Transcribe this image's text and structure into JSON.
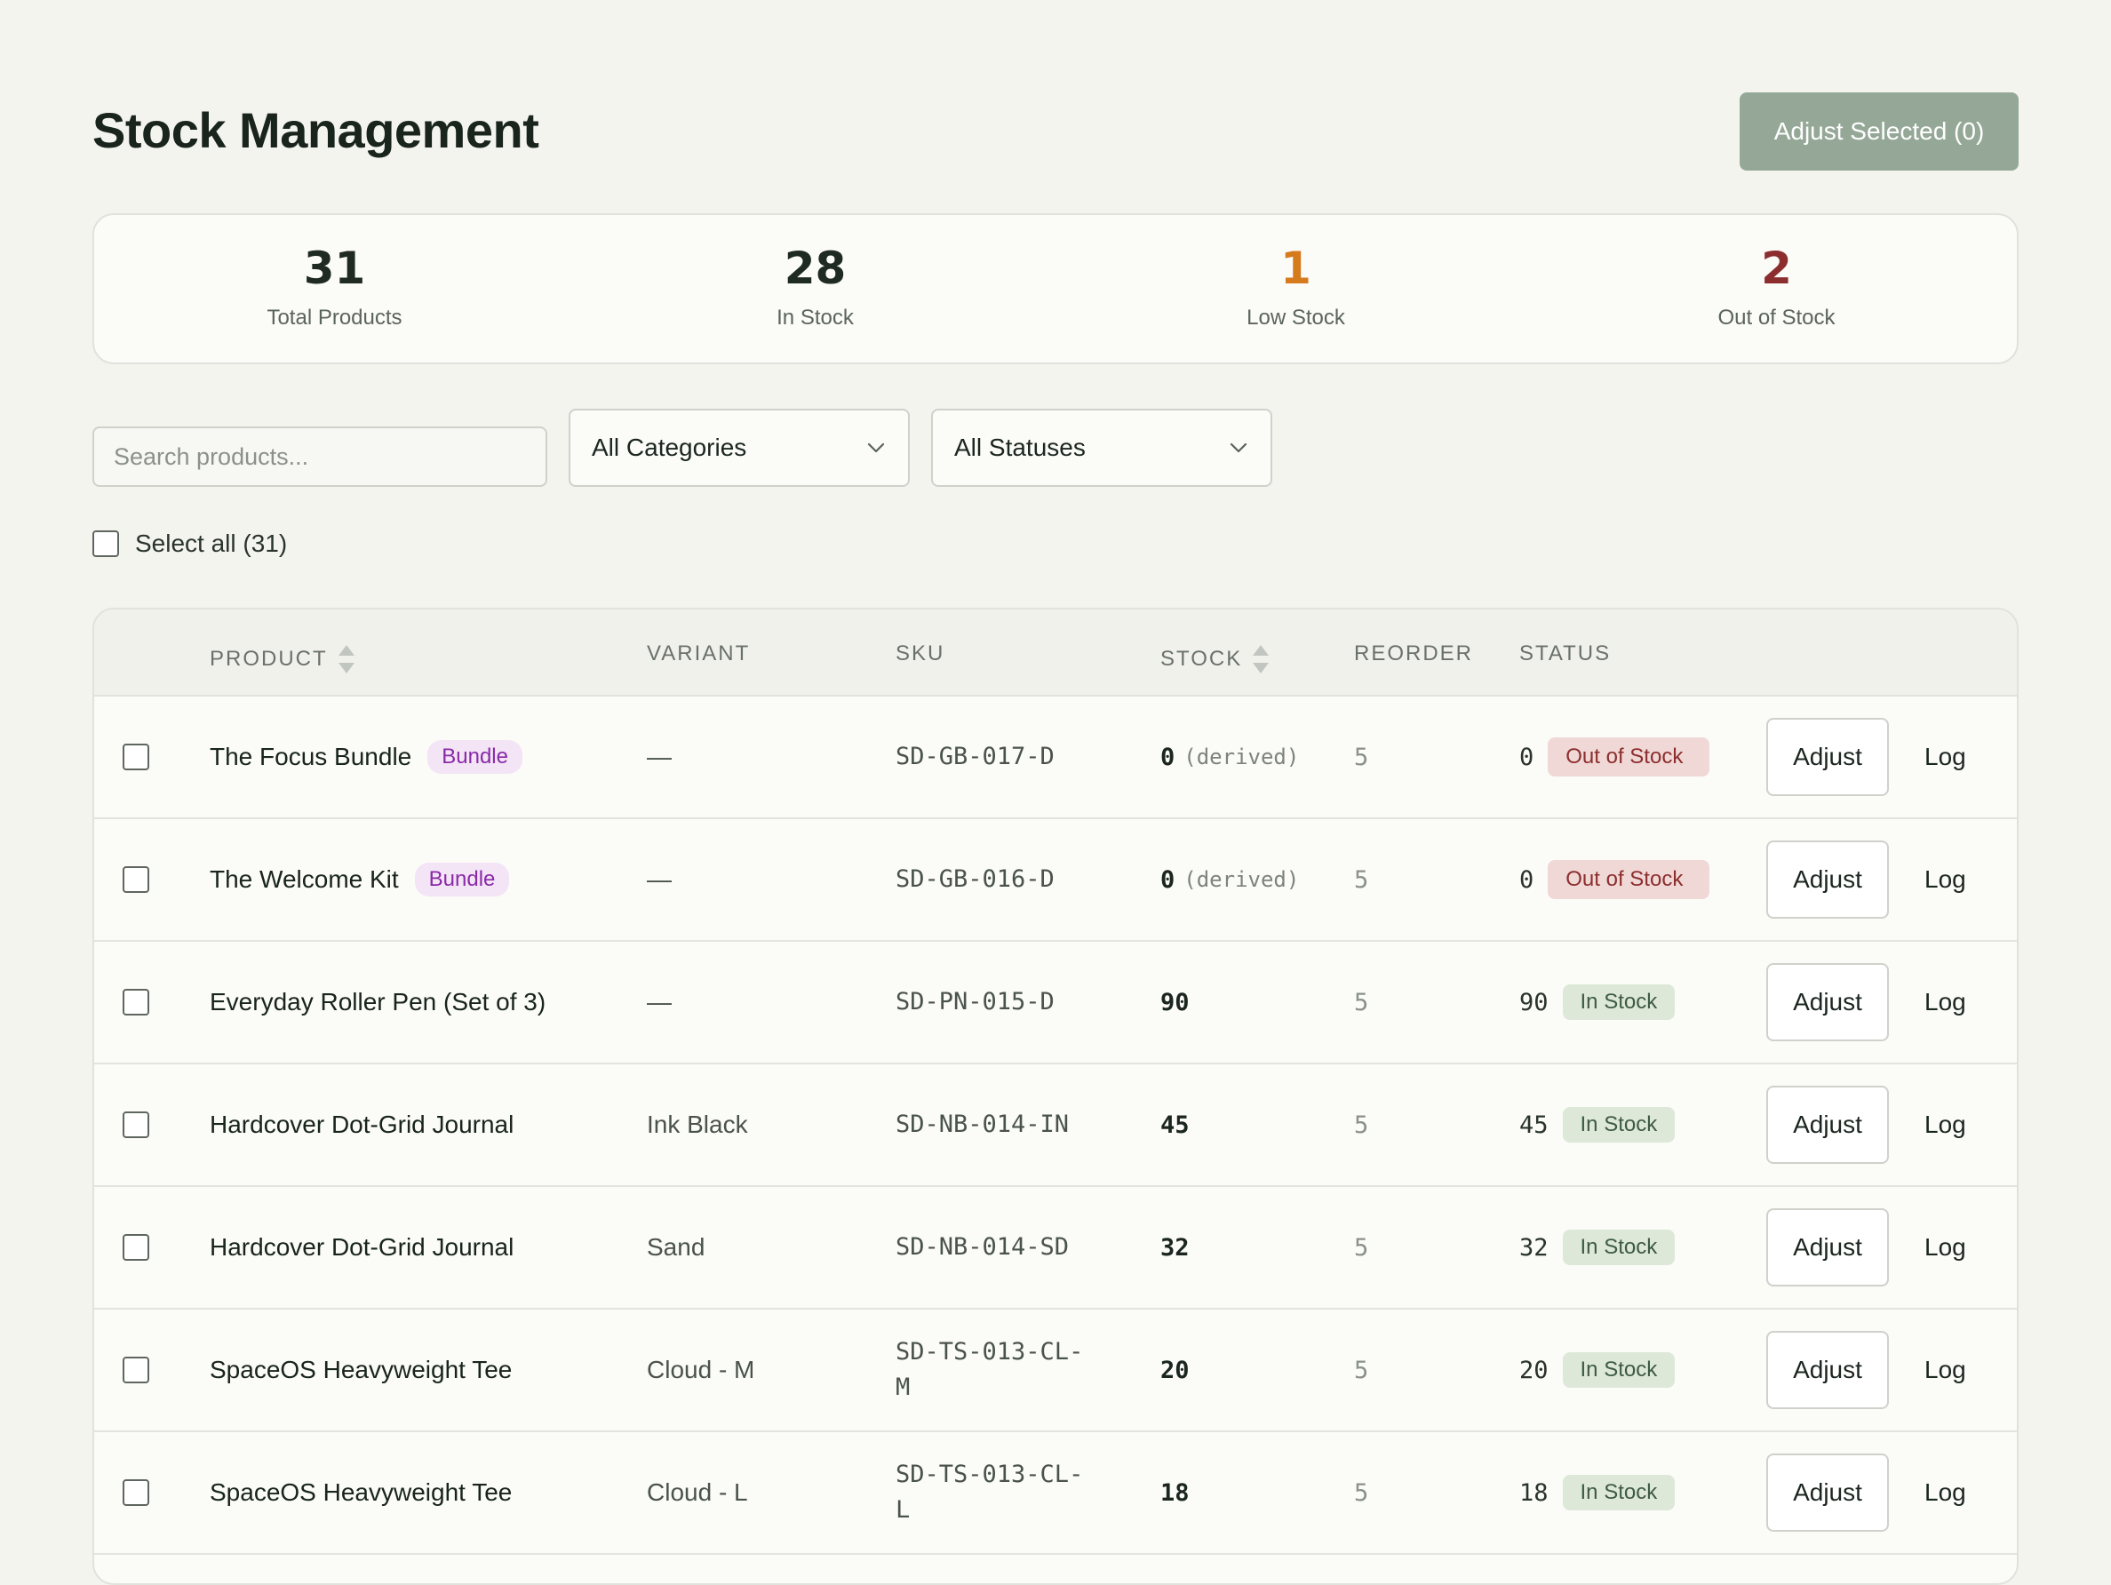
{
  "page": {
    "title": "Stock Management",
    "adjust_selected_label": "Adjust Selected (0)"
  },
  "stats": [
    {
      "value": "31",
      "label": "Total Products"
    },
    {
      "value": "28",
      "label": "In Stock"
    },
    {
      "value": "1",
      "label": "Low Stock"
    },
    {
      "value": "2",
      "label": "Out of Stock"
    }
  ],
  "filters": {
    "search_placeholder": "Search products...",
    "category_selected": "All Categories",
    "status_selected": "All Statuses",
    "select_all_label": "Select all (31)"
  },
  "table": {
    "headers": {
      "product": "PRODUCT",
      "variant": "VARIANT",
      "sku": "SKU",
      "stock": "STOCK",
      "reorder": "REORDER",
      "status": "STATUS"
    },
    "adjust_label": "Adjust",
    "log_label": "Log",
    "derived_label": "(derived)",
    "rows": [
      {
        "product": "The Focus Bundle",
        "badge": "Bundle",
        "variant": "—",
        "sku": "SD-GB-017-D",
        "stock": "0",
        "derived": true,
        "reorder": "5",
        "status_qty": "0",
        "status": "Out of Stock",
        "status_type": "out"
      },
      {
        "product": "The Welcome Kit",
        "badge": "Bundle",
        "variant": "—",
        "sku": "SD-GB-016-D",
        "stock": "0",
        "derived": true,
        "reorder": "5",
        "status_qty": "0",
        "status": "Out of Stock",
        "status_type": "out"
      },
      {
        "product": "Everyday Roller Pen (Set of 3)",
        "badge": "",
        "variant": "—",
        "sku": "SD-PN-015-D",
        "stock": "90",
        "derived": false,
        "reorder": "5",
        "status_qty": "90",
        "status": "In Stock",
        "status_type": "in"
      },
      {
        "product": "Hardcover Dot-Grid Journal",
        "badge": "",
        "variant": "Ink Black",
        "sku": "SD-NB-014-IN",
        "stock": "45",
        "derived": false,
        "reorder": "5",
        "status_qty": "45",
        "status": "In Stock",
        "status_type": "in"
      },
      {
        "product": "Hardcover Dot-Grid Journal",
        "badge": "",
        "variant": "Sand",
        "sku": "SD-NB-014-SD",
        "stock": "32",
        "derived": false,
        "reorder": "5",
        "status_qty": "32",
        "status": "In Stock",
        "status_type": "in"
      },
      {
        "product": "SpaceOS Heavyweight Tee",
        "badge": "",
        "variant": "Cloud - M",
        "sku": "SD-TS-013-CL-M",
        "stock": "20",
        "derived": false,
        "reorder": "5",
        "status_qty": "20",
        "status": "In Stock",
        "status_type": "in"
      },
      {
        "product": "SpaceOS Heavyweight Tee",
        "badge": "",
        "variant": "Cloud - L",
        "sku": "SD-TS-013-CL-L",
        "stock": "18",
        "derived": false,
        "reorder": "5",
        "status_qty": "18",
        "status": "In Stock",
        "status_type": "in"
      }
    ]
  }
}
